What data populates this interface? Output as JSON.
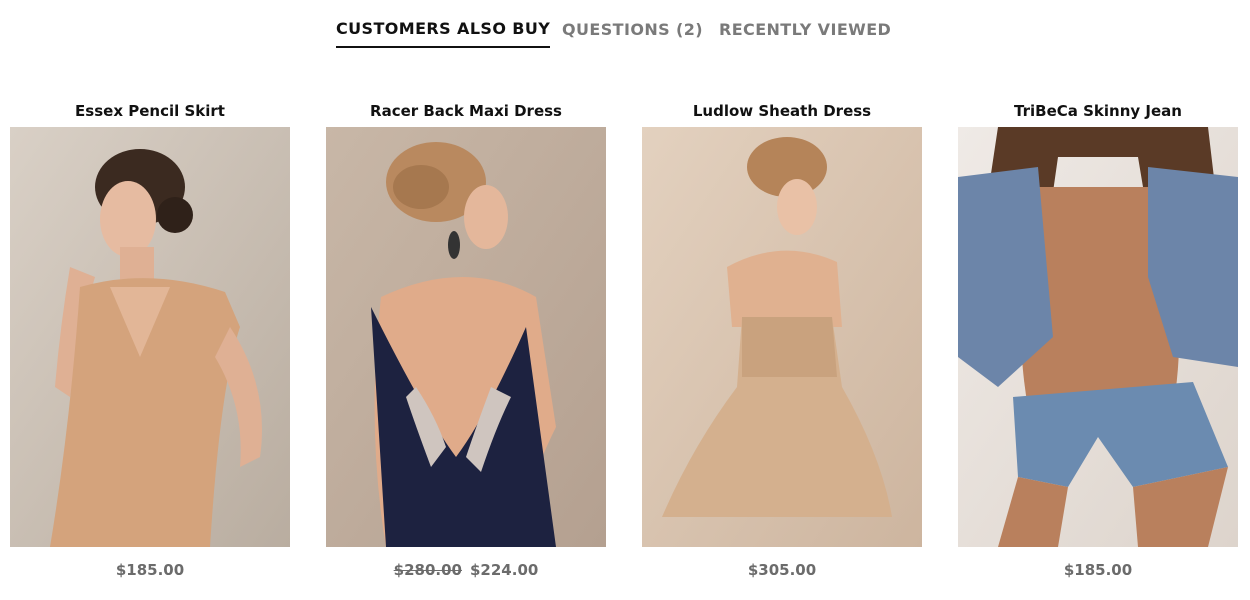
{
  "tabs": [
    {
      "label": "CUSTOMERS ALSO BUY",
      "active": true
    },
    {
      "label": "QUESTIONS (2)",
      "active": false
    },
    {
      "label": "RECENTLY VIEWED",
      "active": false
    }
  ],
  "products": [
    {
      "name": "Essex Pencil Skirt",
      "price": "$185.00",
      "old_price": null
    },
    {
      "name": "Racer Back Maxi Dress",
      "price": "$224.00",
      "old_price": "$280.00"
    },
    {
      "name": "Ludlow Sheath Dress",
      "price": "$305.00",
      "old_price": null
    },
    {
      "name": "TriBeCa Skinny Jean",
      "price": "$185.00",
      "old_price": null
    }
  ],
  "colors": {
    "active_tab": "#111111",
    "inactive_tab": "#7a7a7a",
    "price": "#6b6b6b"
  }
}
